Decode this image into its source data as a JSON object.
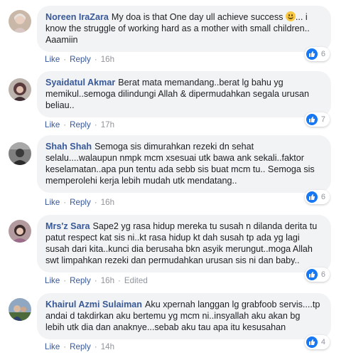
{
  "comments": [
    {
      "author": "Noreen IraZara",
      "text_lines": [
        "My doa is that One day ull achieve success",
        "know the struggle of working hard as a mother with small children..",
        "Aaamiin"
      ],
      "text_suffix": "... i",
      "like_label": "Like",
      "reply_label": "Reply",
      "time": "16h",
      "reaction_count": "6"
    },
    {
      "author": "Syaidatul Akmar",
      "text_lines": [
        "Berat mata memandang..berat lg bahu yg",
        "memikul..semoga dilindungi Allah & dipermudahkan segala urusan",
        "beliau.."
      ],
      "like_label": "Like",
      "reply_label": "Reply",
      "time": "17h",
      "reaction_count": "7"
    },
    {
      "author": "Shah Shah",
      "text_lines": [
        "Semoga sis dimurahkan rezeki dn sehat",
        "selalu....walaupun nmpk mcm xsesuai utk bawa ank sekali..faktor",
        "keselamatan..apa pun tentu ada sebb sis buat mcm tu.. Semoga sis",
        "memperolehi kerja lebih mudah utk mendatang.."
      ],
      "like_label": "Like",
      "reply_label": "Reply",
      "time": "16h",
      "reaction_count": "6"
    },
    {
      "author": "Mrs'z Sara",
      "text_lines": [
        "Sape2 yg rasa hidup mereka tu susah n dilanda derita tu",
        "patut respect kat sis ni..kt rasa hidup kt dah susah tp ada yg lagi",
        "susah dari kita..kunci dia berusaha bkn asyik merungut..moga Allah",
        "swt limpahkan rezeki dan permudahkan urusan sis ni dan baby.."
      ],
      "like_label": "Like",
      "reply_label": "Reply",
      "time": "16h",
      "edited": "Edited",
      "reaction_count": "6"
    },
    {
      "author": "Khairul Azmi Sulaiman",
      "text_lines": [
        "Aku xpernah langgan lg grabfoob servis....tp",
        "andai d takdirkan aku bertemu yg mcm ni..insyallah aku akan bg",
        "lebih utk dia dan anaknye...sebab aku tau apa itu kesusahan"
      ],
      "like_label": "Like",
      "reply_label": "Reply",
      "time": "14h",
      "reaction_count": "4"
    }
  ],
  "colors": {
    "author": "#385898",
    "bubble": "#f2f3f5",
    "like_icon": "#1877f2"
  }
}
